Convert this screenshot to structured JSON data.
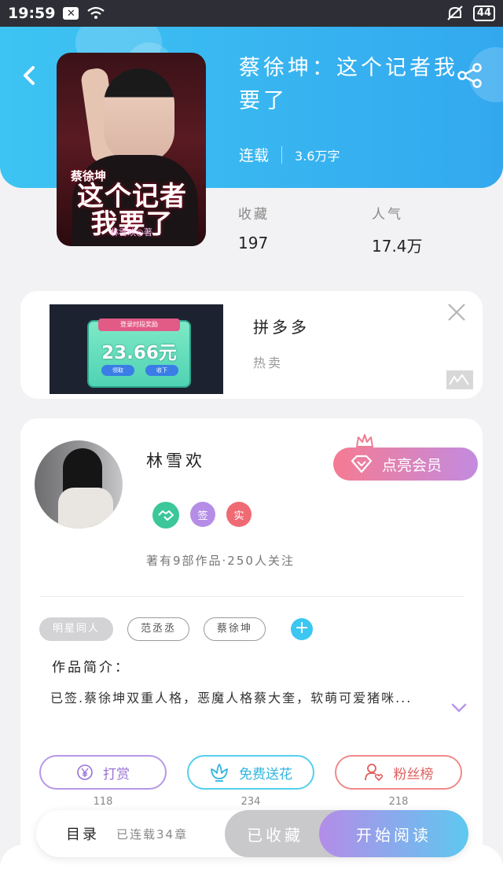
{
  "status_bar": {
    "time": "19:59",
    "battery": "44"
  },
  "book": {
    "title": "蔡徐坤：这个记者我要了",
    "status": "连载",
    "word_count": "3.6万字",
    "cover": {
      "subtitle": "蔡徐坤",
      "line1": "这个记者",
      "line2": "我要了",
      "author_line": "林雪欢◎著"
    },
    "stats": [
      {
        "label": "收藏",
        "value": "197"
      },
      {
        "label": "人气",
        "value": "17.4万"
      }
    ]
  },
  "ad": {
    "title": "拼多多",
    "subtitle": "热卖",
    "image": {
      "ribbon": "登录时段奖励",
      "amount": "23.66元",
      "btn1": "领取",
      "btn2": "收下"
    }
  },
  "author": {
    "name": "林雪欢",
    "vip_label": "点亮会员",
    "badges": [
      {
        "icon": "handshake-icon",
        "text": ""
      },
      {
        "icon": "sign-badge",
        "text": "签"
      },
      {
        "icon": "verified-badge",
        "text": "实"
      }
    ],
    "stats_text": "著有9部作品·250人关注"
  },
  "tags": [
    "明星同人",
    "范丞丞",
    "蔡徐坤"
  ],
  "intro": {
    "title": "作品简介：",
    "text": "已签.蔡徐坤双重人格，恶魔人格蔡大奎，软萌可爱猪咪..."
  },
  "actions": [
    {
      "icon": "yen-icon",
      "label": "打赏",
      "count": "118"
    },
    {
      "icon": "flower-icon",
      "label": "免费送花",
      "count": "234"
    },
    {
      "icon": "user-heart-icon",
      "label": "粉丝榜",
      "count": "218"
    }
  ],
  "bottom": {
    "toc_label": "目录",
    "toc_sub": "已连载34章",
    "collected_label": "已收藏",
    "read_label": "开始阅读"
  },
  "colors": {
    "header_start": "#3dc4f2",
    "header_end": "#33a8ef",
    "vip_start": "#f57b92",
    "vip_end": "#c38be0",
    "read_start": "#b48ce8",
    "read_end": "#5ec8f0"
  }
}
